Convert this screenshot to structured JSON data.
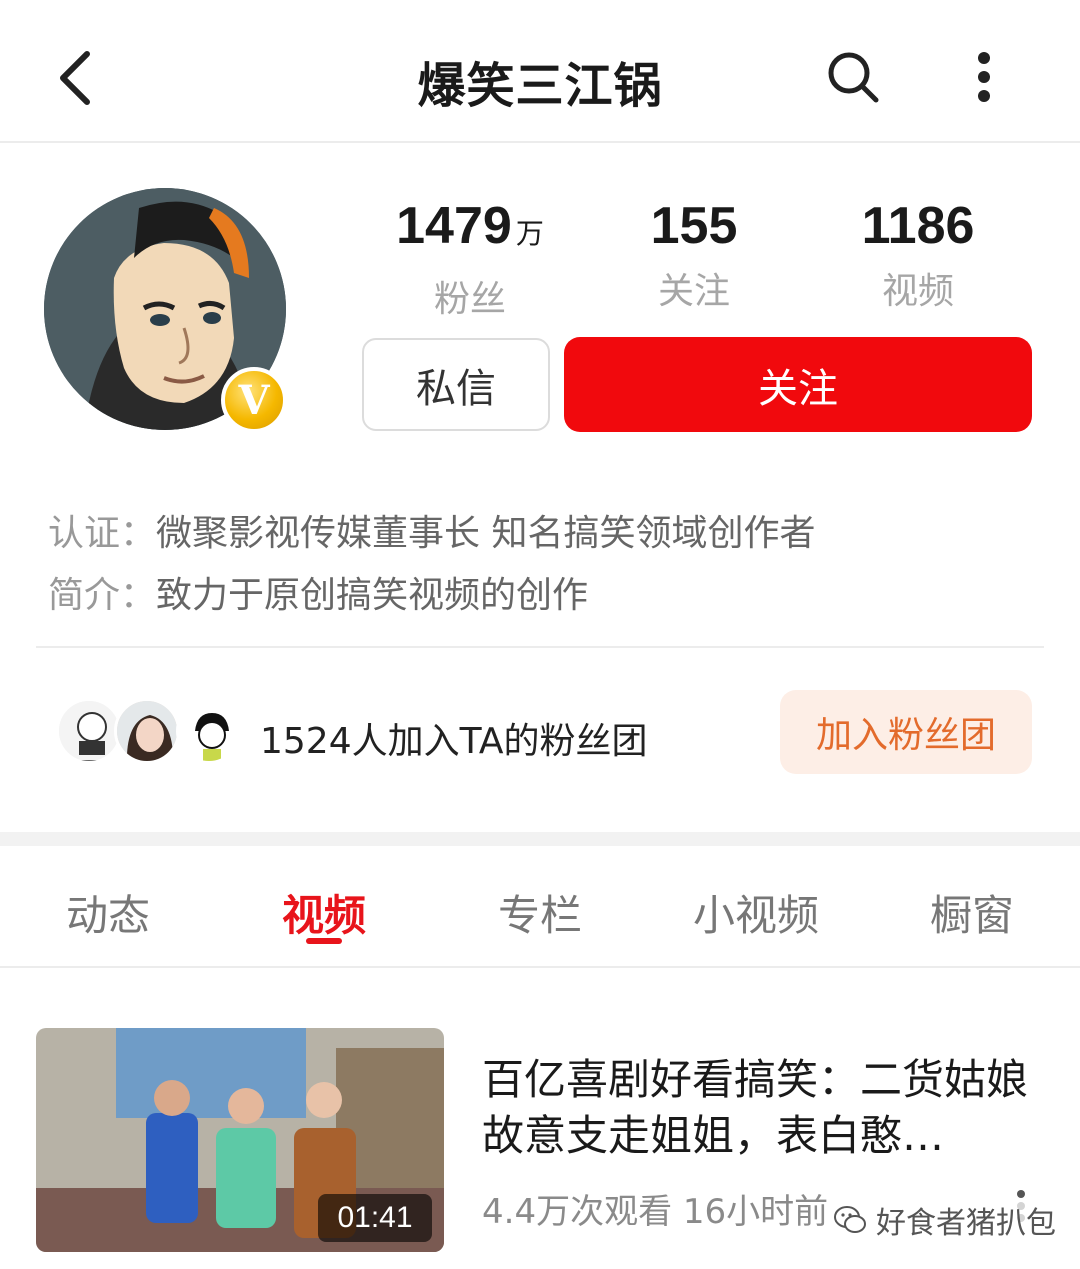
{
  "header": {
    "title": "爆笑三江锅",
    "back_icon": "chevron-left-icon",
    "search_icon": "search-icon",
    "more_icon": "more-vertical-icon"
  },
  "profile": {
    "verified_badge": "V",
    "stats": [
      {
        "value": "1479",
        "unit": "万",
        "label": "粉丝"
      },
      {
        "value": "155",
        "unit": "",
        "label": "关注"
      },
      {
        "value": "1186",
        "unit": "",
        "label": "视频"
      }
    ],
    "message_button": "私信",
    "follow_button": "关注",
    "certification_key": "认证：",
    "certification_value": "微聚影视传媒董事长 知名搞笑领域创作者",
    "intro_key": "简介：",
    "intro_value": "致力于原创搞笑视频的创作"
  },
  "fan_group": {
    "text": "1524人加入TA的粉丝团",
    "join_button": "加入粉丝团"
  },
  "tabs": [
    "动态",
    "视频",
    "专栏",
    "小视频",
    "橱窗"
  ],
  "active_tab": "视频",
  "video": {
    "title": "百亿喜剧好看搞笑：二货姑娘故意支走姐姐，表白憨…",
    "duration": "01:41",
    "meta": "4.4万次观看  16小时前"
  },
  "watermark": "好食者猪扒包",
  "colors": {
    "accent_red": "#f1090d",
    "tab_active": "#e8141b",
    "fan_button_bg": "#fdeee6",
    "fan_button_text": "#e36b2c",
    "verified_gold": "#f5b800"
  }
}
